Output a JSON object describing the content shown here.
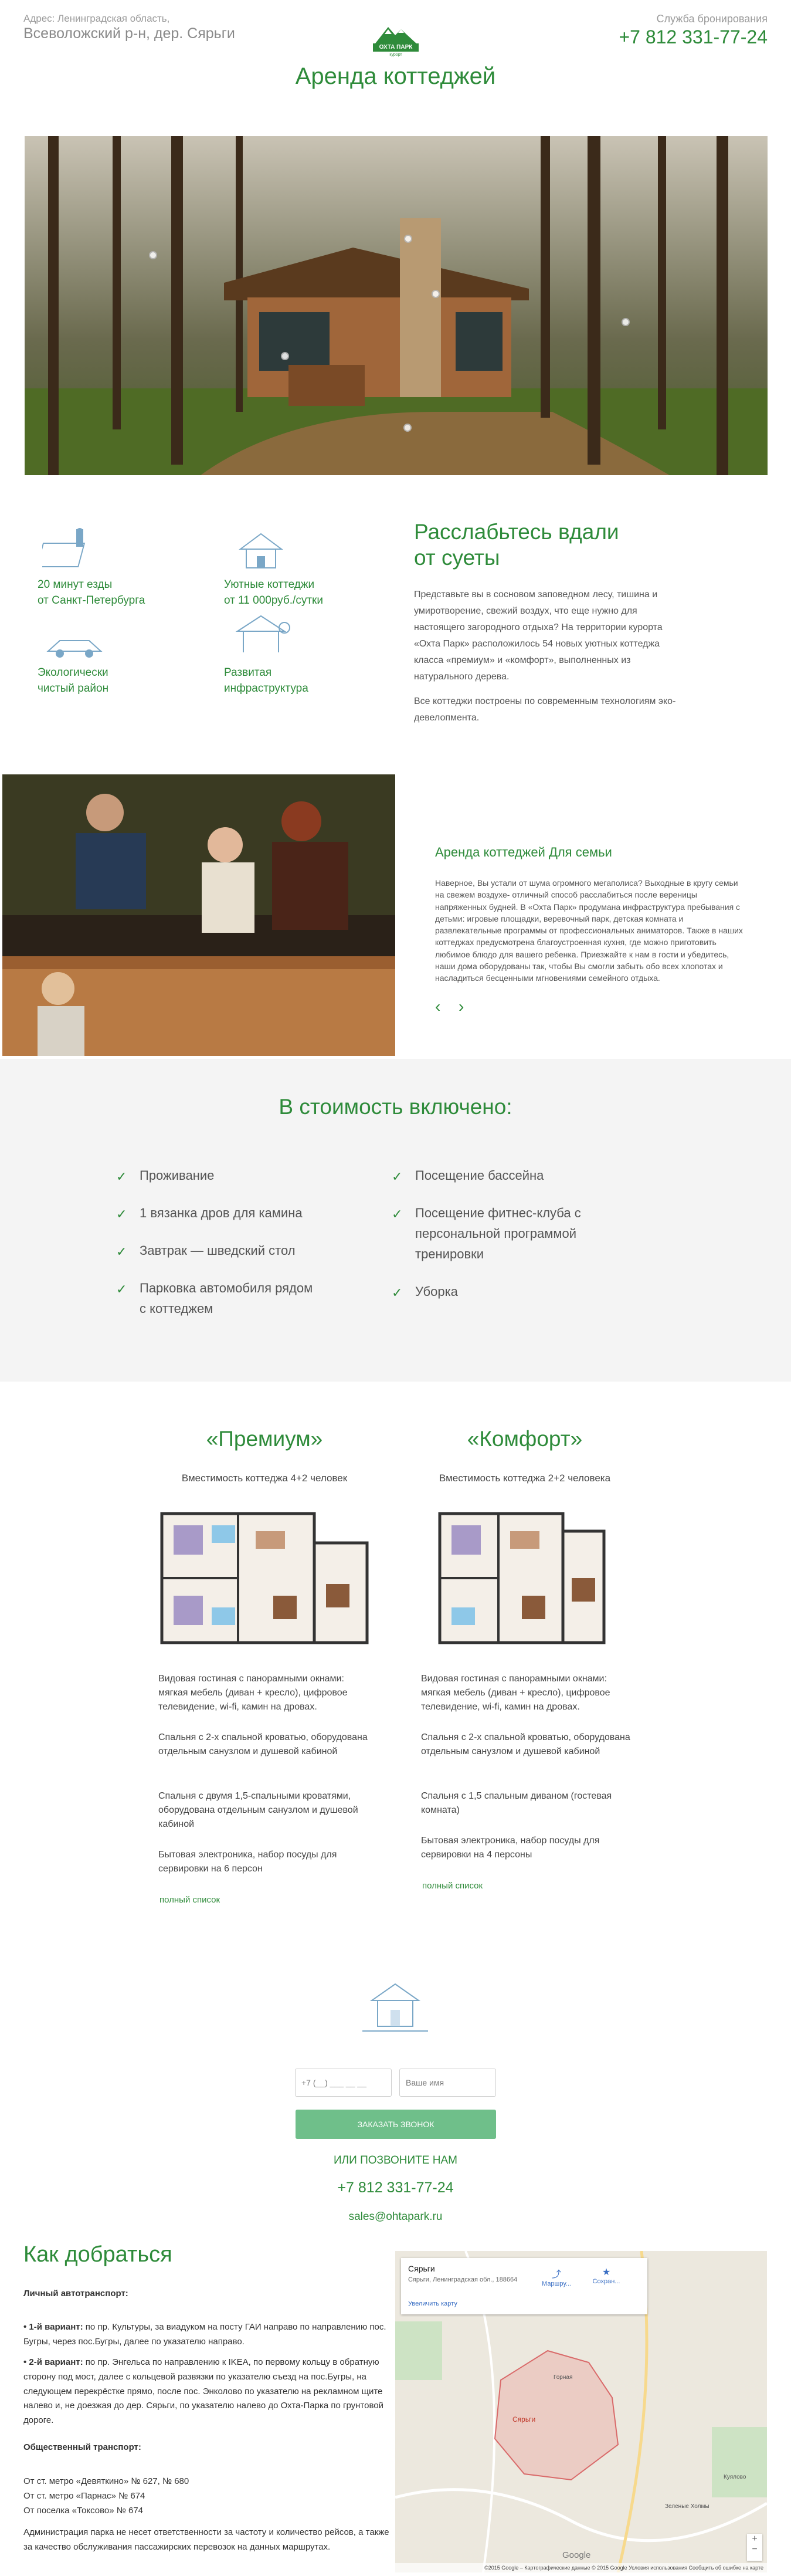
{
  "header": {
    "address_line1": "Адрес: Ленинградская область,",
    "address_line2": "Всеволожский р-н, дер. Сярьги",
    "logo_text": "ОХТА ПАРК",
    "logo_sub": "курорт",
    "booking_label": "Служба бронирования",
    "phone": "+7 812 331-77-24"
  },
  "page_title": "Аренда коттеджей",
  "features": [
    {
      "icon": "map-pin-icon",
      "label": "20 минут езды\nот Санкт-Петербурга"
    },
    {
      "icon": "cottage-icon",
      "label": "Уютные коттеджи\nот 11 000руб./сутки"
    },
    {
      "icon": "car-icon",
      "label": "Экологически\nчистый район"
    },
    {
      "icon": "gazebo-icon",
      "label": "Развитая\nинфраструктура"
    }
  ],
  "relax": {
    "title": "Расслабьтесь вдали\nот суеты",
    "p1": "Представьте вы в сосновом заповедном лесу, тишина и умиротворение, свежий воздух, что еще нужно для настоящего загородного отдыха? На территории курорта «Охта Парк» расположилось 54 новых уютных коттеджа класса «премиум» и «комфорт», выполненных из натурального дерева.",
    "p2": "Все коттеджи построены по современным технологиям эко-девелопмента."
  },
  "family": {
    "title": "Аренда коттеджей Для семьи",
    "text": "Наверное, Вы устали от шума огромного мегаполиса? Выходные в кругу семьи на свежем воздухе- отличный способ расслабиться после вереницы напряженных будней. В «Охта Парк» продумана инфраструктура пребывания с детьми: игровые площадки, веревочный парк, детская комната и развлекательные программы от профессиональных аниматоров. Также в наших коттеджах предусмотрена благоустроенная кухня, где можно приготовить любимое блюдо для вашего ребенка. Приезжайте к нам в гости и убедитесь, наши дома оборудованы так, чтобы Вы смогли забыть обо всех хлопотах и насладиться бесценными мгновениями семейного отдыха.",
    "prev": "‹",
    "next": "›"
  },
  "included": {
    "title": "В стоимость включено:",
    "left": [
      "Проживание",
      "1 вязанка дров для камина",
      "Завтрак — шведский стол",
      "Парковка автомобиля рядом\nс коттеджем"
    ],
    "right": [
      "Посещение бассейна",
      "Посещение фитнес-клуба с\nперсональной программой\nтренировки",
      "Уборка"
    ]
  },
  "cottages": [
    {
      "title": "«Премиум»",
      "capacity": "Вместимость коттеджа 4+2 человек",
      "items": [
        "Видовая гостиная с панорамными окнами: мягкая мебель (диван + кресло), цифровое телевидение, wi-fi, камин на дровах.",
        "Спальня с 2-х спальной кроватью, оборудована отдельным санузлом и душевой кабиной",
        "Спальня с двумя 1,5-спальными кроватями, оборудована отдельным санузлом и душевой кабиной",
        "Бытовая электроника, набор посуды для сервировки на 6 персон"
      ],
      "link": "полный список"
    },
    {
      "title": "«Комфорт»",
      "capacity": "Вместимость коттеджа 2+2 человека",
      "items": [
        "Видовая гостиная с панорамными окнами: мягкая мебель (диван + кресло), цифровое телевидение, wi-fi, камин на дровах.",
        "Спальня с 2-х спальной кроватью, оборудована отдельным санузлом и душевой кабиной",
        "Спальня с 1,5 спальным диваном (гостевая комната)",
        "Бытовая электроника, набор посуды для сервировки на 4 персоны"
      ],
      "link": "полный список"
    }
  ],
  "callback": {
    "phone_placeholder": "+7 (__) ___ __ __",
    "name_placeholder": "Ваше имя",
    "button": "ЗАКАЗАТЬ ЗВОНОК",
    "or_call": "ИЛИ ПОЗВОНИТЕ НАМ",
    "phone": "+7 812 331-77-24",
    "email": "sales@ohtapark.ru"
  },
  "directions": {
    "title": "Как добраться",
    "car_heading": "Личный автотранспорт:",
    "v1_label": "• 1-й вариант:",
    "v1_text": " по пр. Культуры, за виадуком на посту ГАИ направо по направлению пос. Бугры, через пос.Бугры, далее по указателю направо.",
    "v2_label": "• 2-й вариант:",
    "v2_text": " по пр. Энгельса по направлению к IKEA, по первому кольцу в обратную сторону под мост, далее с кольцевой развязки по указателю съезд на пос.Бугры, на следующем перекрёстке прямо, после пос. Энколово по указателю на рекламном щите налево и, не доезжая до дер. Сярьги, по указателю налево до Охта-Парка по грунтовой дороге.",
    "public_heading": "Общественный транспорт:",
    "public_lines": [
      "От ст. метро «Девяткино» № 627, № 680",
      "От ст. метро «Парнас» № 674",
      "От поселка «Токсово» № 674"
    ],
    "note": "Администрация парка не несет ответственности за частоту и количество рейсов, а также за качество обслуживания пассажирских перевозок на данных маршрутах."
  },
  "map": {
    "place": "Сярьги",
    "place_addr": "Сярьги, Ленинградская обл., 188664",
    "enlarge": "Увеличить карту",
    "route": "Маршру...",
    "save": "Сохран...",
    "label_village": "Сярьги",
    "label_road": "Горная",
    "label_hills": "Зеленые Холмы",
    "label_kuyaly": "Куялово",
    "brand": "Google",
    "footer": "©2015 Google – Картографические данные © 2015 Google   Условия использования   Сообщить об ошибке на карте",
    "zoom_in": "+",
    "zoom_out": "−"
  }
}
